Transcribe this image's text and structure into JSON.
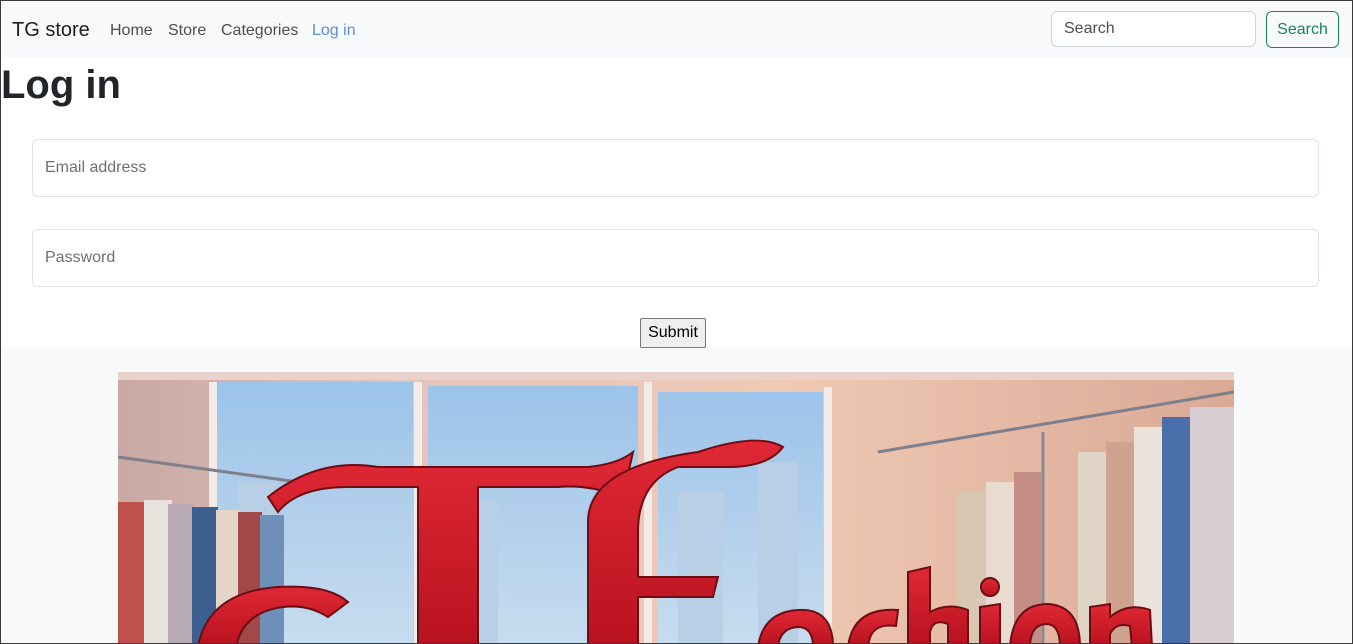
{
  "navbar": {
    "brand": "TG store",
    "links": [
      {
        "label": "Home",
        "active": false
      },
      {
        "label": "Store",
        "active": false
      },
      {
        "label": "Categories",
        "active": false
      },
      {
        "label": "Log in",
        "active": true
      }
    ],
    "search": {
      "placeholder": "Search",
      "value": ""
    },
    "search_button": "Search"
  },
  "login": {
    "title": "Log in",
    "email": {
      "placeholder": "Email address",
      "value": ""
    },
    "password": {
      "placeholder": "Password",
      "value": ""
    },
    "submit_label": "Submit"
  },
  "hero": {
    "logo_text": "TG Fashion",
    "description": "illustrated clothing store interior with red TG Fashion logo"
  },
  "colors": {
    "navbar_bg": "#f8f9fa",
    "active_link": "#5a8fd6",
    "search_button": "#198754",
    "logo_red": "#d4202c"
  }
}
